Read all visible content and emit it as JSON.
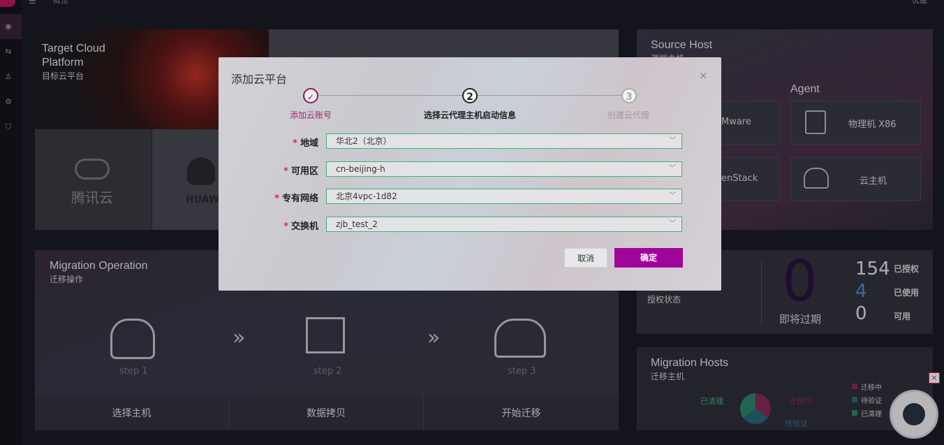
{
  "topbar": {
    "breadcrumb": "概览",
    "user": "优霆"
  },
  "target_cloud": {
    "title": "Target Cloud Platform",
    "subtitle": "目标云平台",
    "providers": [
      "腾讯云",
      "HUAW"
    ]
  },
  "source_host": {
    "title": "Source Host",
    "subtitle": "源端主机",
    "agent_label": "Agent",
    "tiles": [
      "Mware",
      "物理机 X86",
      "enStack",
      "云主机"
    ]
  },
  "migration_operation": {
    "title": "Migration Operation",
    "subtitle": "迁移操作",
    "steps": [
      "step 1",
      "step 2",
      "step 3"
    ],
    "tabs": [
      "选择主机",
      "数据拷贝",
      "开始迁移"
    ]
  },
  "license": {
    "status_label": "授权状态",
    "expiring_value": "0",
    "expiring_label": "即将过期",
    "stats": [
      {
        "value": "154",
        "label": "已授权"
      },
      {
        "value": "4",
        "label": "已使用"
      },
      {
        "value": "0",
        "label": "可用"
      }
    ]
  },
  "migration_hosts": {
    "title": "Migration Hosts",
    "subtitle": "迁移主机",
    "legend": [
      "迁移中",
      "待验证",
      "已清理"
    ],
    "callouts": [
      "已清理",
      "迁移中",
      "待验证"
    ]
  },
  "modal": {
    "title": "添加云平台",
    "close": "×",
    "steps": [
      {
        "label": "添加云账号",
        "mark": "✓"
      },
      {
        "label": "选择云代理主机启动信息",
        "mark": "2"
      },
      {
        "label": "创建云代理",
        "mark": "3"
      }
    ],
    "fields": [
      {
        "label": "地域",
        "value": "华北2（北京）"
      },
      {
        "label": "可用区",
        "value": "cn-beijing-h"
      },
      {
        "label": "专有网络",
        "value": "北京4vpc-1d82"
      },
      {
        "label": "交换机",
        "value": "zjb_test_2"
      }
    ],
    "required_mark": "*",
    "cancel_label": "取消",
    "ok_label": "确定"
  },
  "colors": {
    "accent": "#a0059a",
    "valid_border": "#3cb371",
    "required": "#e0244a"
  }
}
